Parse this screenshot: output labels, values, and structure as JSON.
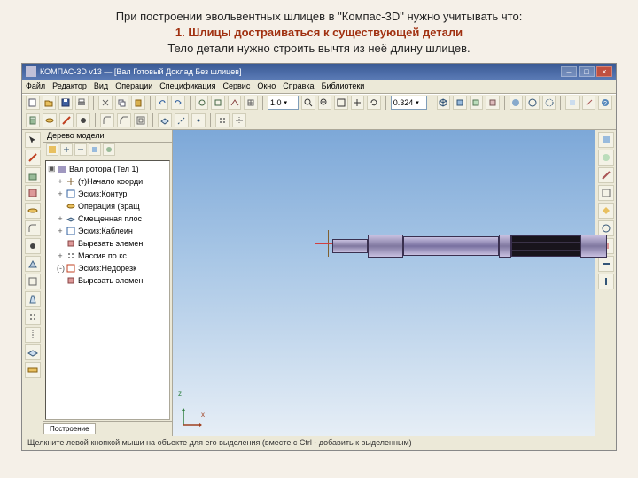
{
  "header": {
    "line1": "При построении эвольвентных шлицев в \"Компас-3D\" нужно учитывать что:",
    "line2": "1. Шлицы достраиваться к существующей детали",
    "line3": "Тело детали нужно строить вычтя из неё длину шлицев."
  },
  "titlebar": {
    "title": "КОМПАС-3D v13 — [Вал Готовый Доклад Без шлицев]"
  },
  "menu": {
    "items": [
      "Файл",
      "Редактор",
      "Вид",
      "Операции",
      "Спецификация",
      "Сервис",
      "Окно",
      "Справка",
      "Библиотеки"
    ]
  },
  "toolbars": {
    "field1": "1.0",
    "field2": "0.324"
  },
  "tree": {
    "header": "Дерево модели",
    "root": "Вал ротора (Тел 1)",
    "items": [
      {
        "twist": "+",
        "label": "(т)Начало коорди",
        "icon": "origin"
      },
      {
        "twist": "+",
        "label": "Эскиз:Контур",
        "icon": "sketch"
      },
      {
        "twist": "",
        "label": "Операция (вращ",
        "icon": "op"
      },
      {
        "twist": "+",
        "label": "Смещенная плос",
        "icon": "plane"
      },
      {
        "twist": "+",
        "label": "Эскиз:Каблеин",
        "icon": "sketch"
      },
      {
        "twist": "",
        "label": "Вырезать элемен",
        "icon": "cut"
      },
      {
        "twist": "+",
        "label": "Массив по кс",
        "icon": "array"
      },
      {
        "twist": "(-)",
        "label": "Эскиз:Недорезк",
        "icon": "sketch-bad"
      },
      {
        "twist": "",
        "label": "Вырезать элемен",
        "icon": "cut"
      }
    ],
    "tab": "Построение"
  },
  "axes": {
    "x": "x",
    "z": "z"
  },
  "status": "Щелкните левой кнопкой мыши на объекте для его выделения (вместе с Ctrl - добавить к выделенным)",
  "icons": {
    "new": "new",
    "open": "open",
    "save": "save",
    "print": "print"
  }
}
